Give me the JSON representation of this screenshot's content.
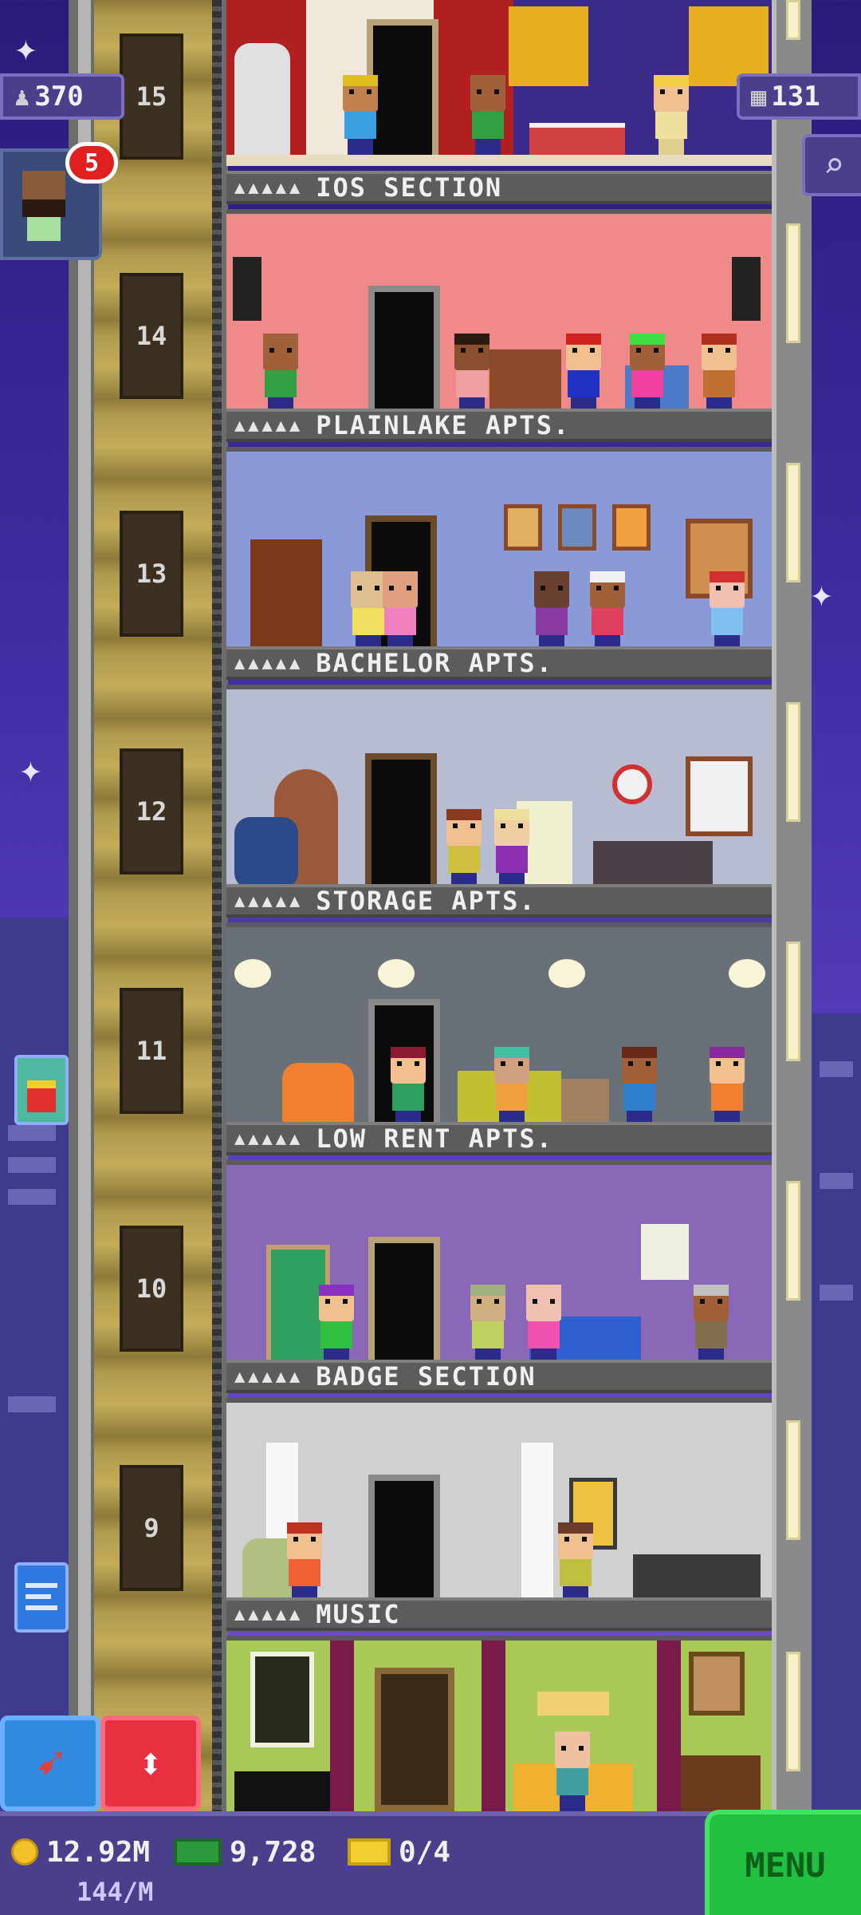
{
  "hud": {
    "population": "370",
    "floor_count": "131"
  },
  "visitor": {
    "badge_count": "5"
  },
  "floors": [
    {
      "number": "15",
      "name": "IOS SECTION",
      "rating": "▲▲▲▲▲"
    },
    {
      "number": "14",
      "name": "PLAINLAKE APTS.",
      "rating": "▲▲▲▲▲"
    },
    {
      "number": "13",
      "name": "BACHELOR APTS.",
      "rating": "▲▲▲▲▲"
    },
    {
      "number": "12",
      "name": "STORAGE APTS.",
      "rating": "▲▲▲▲▲"
    },
    {
      "number": "11",
      "name": "LOW RENT APTS.",
      "rating": "▲▲▲▲▲"
    },
    {
      "number": "10",
      "name": "BADGE SECTION",
      "rating": "▲▲▲▲▲"
    },
    {
      "number": "9",
      "name": "MUSIC",
      "rating": "▲▲▲▲▲"
    }
  ],
  "status": {
    "coins": "12.92M",
    "coins_rate": "144/M",
    "bux": "9,728",
    "tickets": "0/4"
  },
  "menu": {
    "label": "MENU"
  },
  "icons": {
    "population": "person-icon",
    "floors": "building-icon",
    "search": "magnifier-icon",
    "coins": "coin-icon",
    "bux": "bux-icon",
    "tickets": "ticket-icon",
    "rebuild": "hammer-icon",
    "elevator": "elevator-arrows-icon"
  },
  "colors": {
    "sky": "#3d2b9e",
    "menu_green": "#22c040",
    "badge_red": "#e02020",
    "elevator_red": "#e83040",
    "tool_blue": "#2f8ae0"
  }
}
